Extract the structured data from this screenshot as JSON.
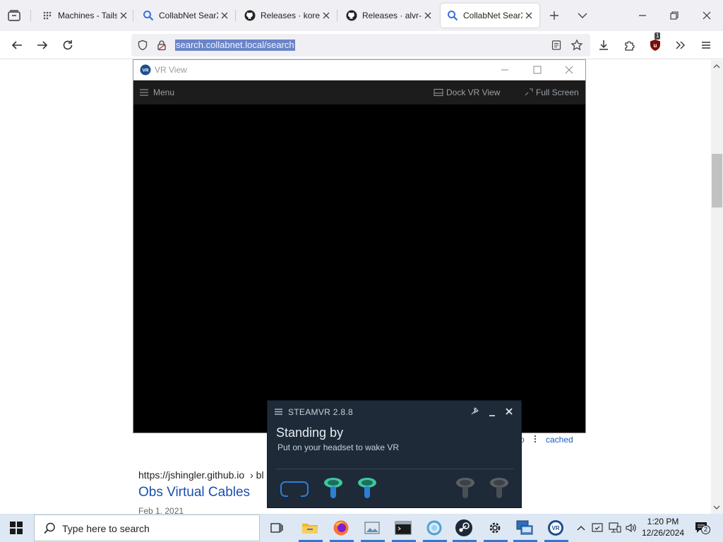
{
  "browser": {
    "tabs": [
      {
        "label": "Machines - Tails",
        "icon": "grid-dots-icon"
      },
      {
        "label": "CollabNet SearX",
        "icon": "search-icon"
      },
      {
        "label": "Releases · korej",
        "icon": "github-icon"
      },
      {
        "label": "Releases · alvr-o",
        "icon": "github-icon"
      },
      {
        "label": "CollabNet SearX",
        "icon": "search-icon",
        "active": true
      }
    ],
    "url": "search.collabnet.local/search",
    "extension_badge": "1"
  },
  "page": {
    "result_meta_link": "cached",
    "result_meta_partial": "b",
    "result_url": "https://jshingler.github.io",
    "result_url_suffix": "› bl",
    "result_title": "Obs Virtual Cables",
    "result_date": "Feb 1, 2021"
  },
  "vr_view": {
    "title": "VR View",
    "menu_label": "Menu",
    "dock_label": "Dock VR View",
    "fullscreen_label": "Full Screen"
  },
  "steamvr": {
    "title": "STEAMVR 2.8.8",
    "status": "Standing by",
    "substatus": "Put on your headset to wake VR",
    "colors": {
      "active": "#3ec7a0",
      "inactive": "#5a5f66",
      "headset": "#2d7fd6"
    }
  },
  "taskbar": {
    "search_placeholder": "Type here to search",
    "time": "1:20 PM",
    "date": "12/26/2024",
    "notification_count": "2"
  }
}
